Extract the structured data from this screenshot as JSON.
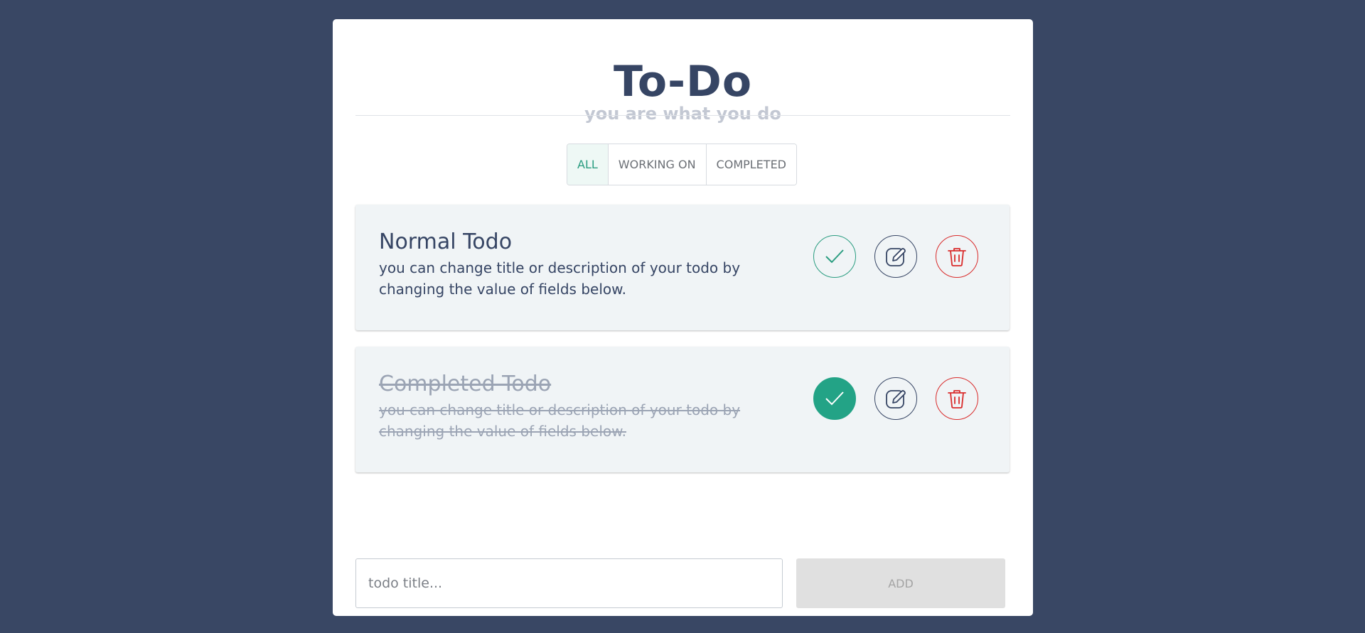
{
  "header": {
    "title": "To-Do",
    "subtitle": "you are what you do"
  },
  "filters": [
    {
      "label": "ALL",
      "active": true
    },
    {
      "label": "WORKING ON",
      "active": false
    },
    {
      "label": "COMPLETED",
      "active": false
    }
  ],
  "todos": [
    {
      "title": "Normal Todo",
      "description": "you can change title or description of your todo by changing the value of fields below.",
      "completed": false
    },
    {
      "title": "Completed Todo",
      "description": "you can change title or description of your todo by changing the value of fields below.",
      "completed": true
    }
  ],
  "icons": {
    "complete": "check-icon",
    "edit": "edit-icon",
    "delete": "trash-icon"
  },
  "colors": {
    "background": "#394764",
    "primary_text": "#364564",
    "accent_green": "#23a386",
    "delete_red": "#d92b2b"
  },
  "add_form": {
    "placeholder": "todo title...",
    "value": "",
    "button_label": "ADD"
  }
}
